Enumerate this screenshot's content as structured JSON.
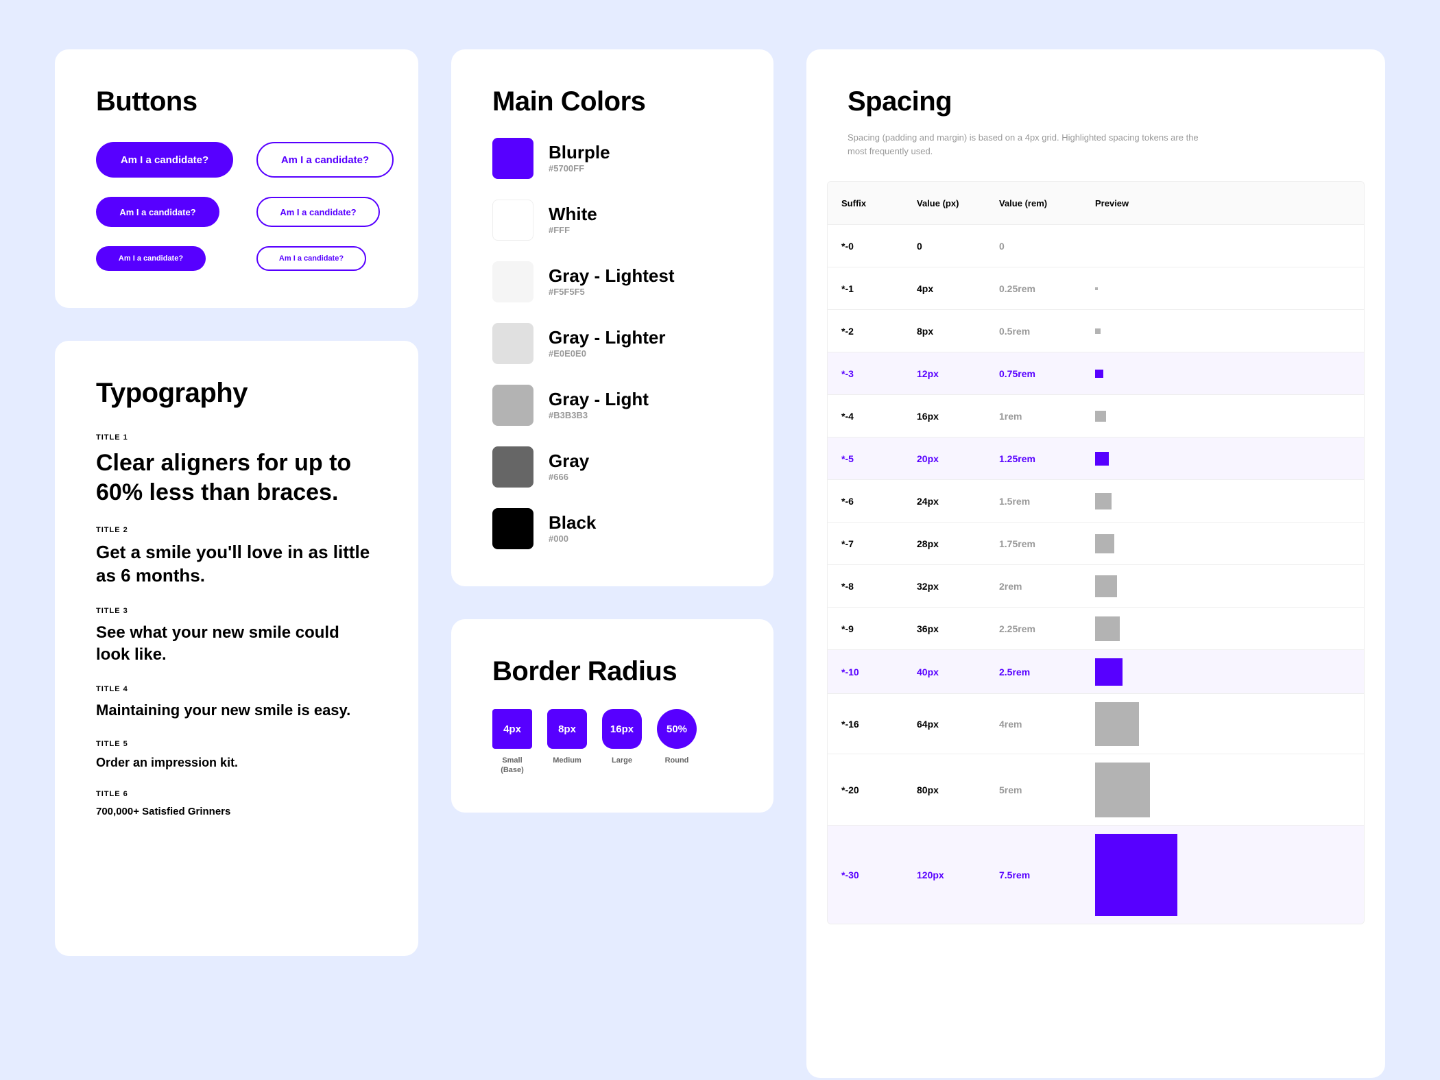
{
  "buttons": {
    "title": "Buttons",
    "label": "Am I a candidate?"
  },
  "typography": {
    "title": "Typography",
    "items": [
      {
        "label": "TITLE 1",
        "text": "Clear aligners for up to 60% less than braces."
      },
      {
        "label": "TITLE 2",
        "text": "Get a smile you'll love in as little as 6 months."
      },
      {
        "label": "TITLE 3",
        "text": "See what your new smile could look like."
      },
      {
        "label": "TITLE 4",
        "text": "Maintaining your new smile is easy."
      },
      {
        "label": "TITLE 5",
        "text": "Order an impression kit."
      },
      {
        "label": "TITLE 6",
        "text": "700,000+ Satisfied Grinners"
      }
    ]
  },
  "colors": {
    "title": "Main Colors",
    "items": [
      {
        "name": "Blurple",
        "hex": "#5700FF"
      },
      {
        "name": "White",
        "hex": "#FFF"
      },
      {
        "name": "Gray - Lightest",
        "hex": "#F5F5F5"
      },
      {
        "name": "Gray - Lighter",
        "hex": "#E0E0E0"
      },
      {
        "name": "Gray - Light",
        "hex": "#B3B3B3"
      },
      {
        "name": "Gray",
        "hex": "#666"
      },
      {
        "name": "Black",
        "hex": "#000"
      }
    ]
  },
  "radius": {
    "title": "Border Radius",
    "items": [
      {
        "value": "4px",
        "label": "Small (Base)",
        "css": "4px"
      },
      {
        "value": "8px",
        "label": "Medium",
        "css": "8px"
      },
      {
        "value": "16px",
        "label": "Large",
        "css": "16px"
      },
      {
        "value": "50%",
        "label": "Round",
        "css": "50%"
      }
    ]
  },
  "spacing": {
    "title": "Spacing",
    "description": "Spacing (padding and margin) is based on a 4px grid. Highlighted spacing tokens are the most frequently used.",
    "headers": {
      "suffix": "Suffix",
      "px": "Value (px)",
      "rem": "Value (rem)",
      "preview": "Preview"
    },
    "rows": [
      {
        "suffix": "*-0",
        "px": "0",
        "rem": "0",
        "size": 0,
        "highlight": false
      },
      {
        "suffix": "*-1",
        "px": "4px",
        "rem": "0.25rem",
        "size": 4,
        "highlight": false
      },
      {
        "suffix": "*-2",
        "px": "8px",
        "rem": "0.5rem",
        "size": 8,
        "highlight": false
      },
      {
        "suffix": "*-3",
        "px": "12px",
        "rem": "0.75rem",
        "size": 12,
        "highlight": true
      },
      {
        "suffix": "*-4",
        "px": "16px",
        "rem": "1rem",
        "size": 16,
        "highlight": false
      },
      {
        "suffix": "*-5",
        "px": "20px",
        "rem": "1.25rem",
        "size": 20,
        "highlight": true
      },
      {
        "suffix": "*-6",
        "px": "24px",
        "rem": "1.5rem",
        "size": 24,
        "highlight": false
      },
      {
        "suffix": "*-7",
        "px": "28px",
        "rem": "1.75rem",
        "size": 28,
        "highlight": false
      },
      {
        "suffix": "*-8",
        "px": "32px",
        "rem": "2rem",
        "size": 32,
        "highlight": false
      },
      {
        "suffix": "*-9",
        "px": "36px",
        "rem": "2.25rem",
        "size": 36,
        "highlight": false
      },
      {
        "suffix": "*-10",
        "px": "40px",
        "rem": "2.5rem",
        "size": 40,
        "highlight": true
      },
      {
        "suffix": "*-16",
        "px": "64px",
        "rem": "4rem",
        "size": 64,
        "highlight": false
      },
      {
        "suffix": "*-20",
        "px": "80px",
        "rem": "5rem",
        "size": 80,
        "highlight": false
      },
      {
        "suffix": "*-30",
        "px": "120px",
        "rem": "7.5rem",
        "size": 120,
        "highlight": true
      }
    ]
  },
  "brand_color": "#5700FF"
}
